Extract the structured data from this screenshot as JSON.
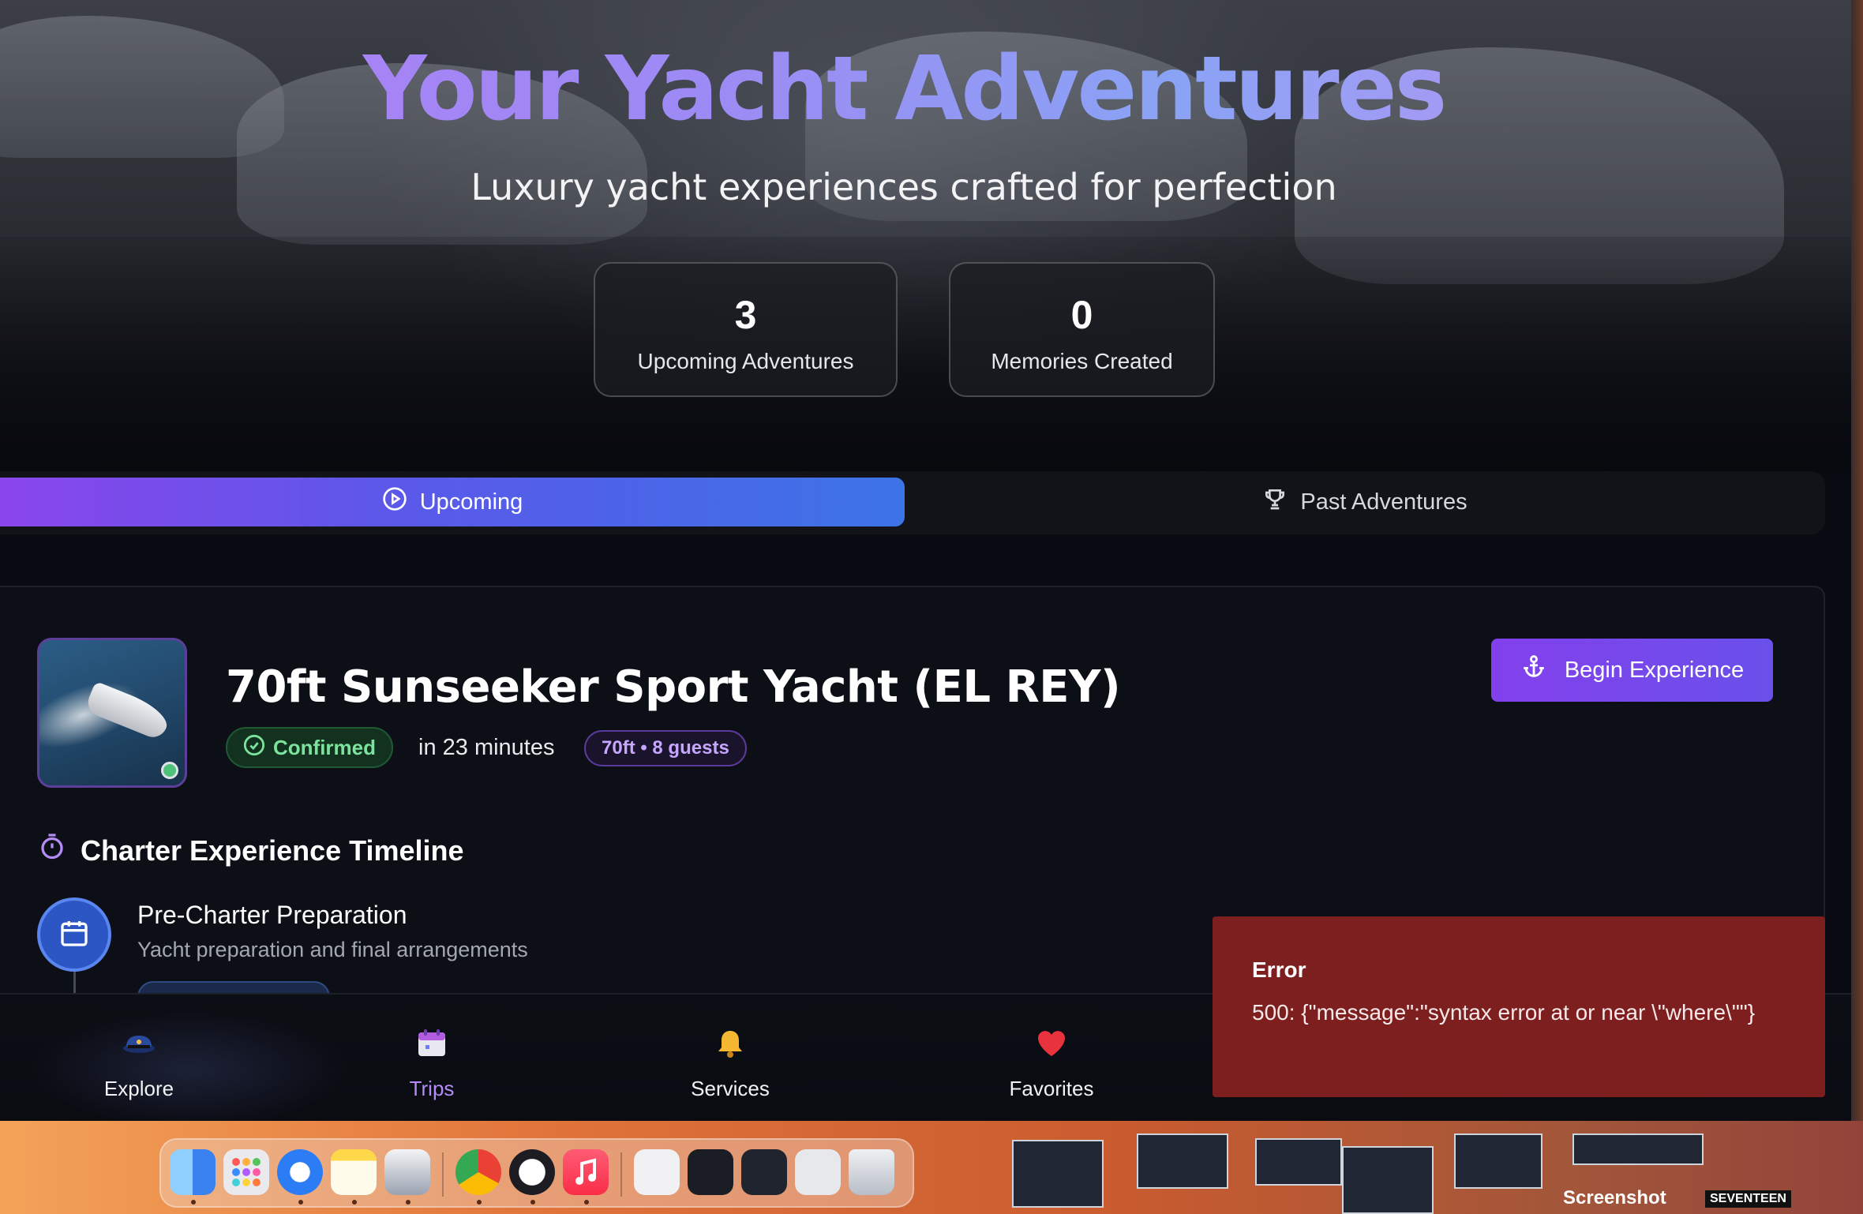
{
  "hero": {
    "title": "Your Yacht Adventures",
    "subtitle": "Luxury yacht experiences crafted for perfection",
    "stats": [
      {
        "value": "3",
        "label": "Upcoming Adventures"
      },
      {
        "value": "0",
        "label": "Memories Created"
      }
    ]
  },
  "tabs": {
    "upcoming": "Upcoming",
    "past": "Past Adventures",
    "active": "upcoming"
  },
  "charter": {
    "title": "70ft Sunseeker Sport Yacht (EL REY)",
    "status": "Confirmed",
    "time": "in 23 minutes",
    "size": "70ft • 8 guests",
    "action": "Begin Experience"
  },
  "timeline": {
    "heading": "Charter Experience Timeline",
    "steps": [
      {
        "title": "Pre-Charter Preparation",
        "description": "Yacht preparation and final arrangements"
      }
    ]
  },
  "bottom_nav": {
    "items": [
      {
        "label": "Explore",
        "icon": "captain-hat-icon"
      },
      {
        "label": "Trips",
        "icon": "calendar-icon",
        "active": true
      },
      {
        "label": "Services",
        "icon": "bell-icon"
      },
      {
        "label": "Favorites",
        "icon": "heart-icon"
      }
    ]
  },
  "error": {
    "title": "Error",
    "message": "500: {\"message\":\"syntax error at or near \\\"where\\\"\"}"
  },
  "desktop": {
    "thumbnail_labels": [
      "Screenshot",
      "SEVENTEEN"
    ]
  },
  "colors": {
    "accent_purple": "#8340ec",
    "accent_blue": "#3c73e7",
    "success_green": "#7be39b",
    "error_red": "#7d1f1f"
  }
}
